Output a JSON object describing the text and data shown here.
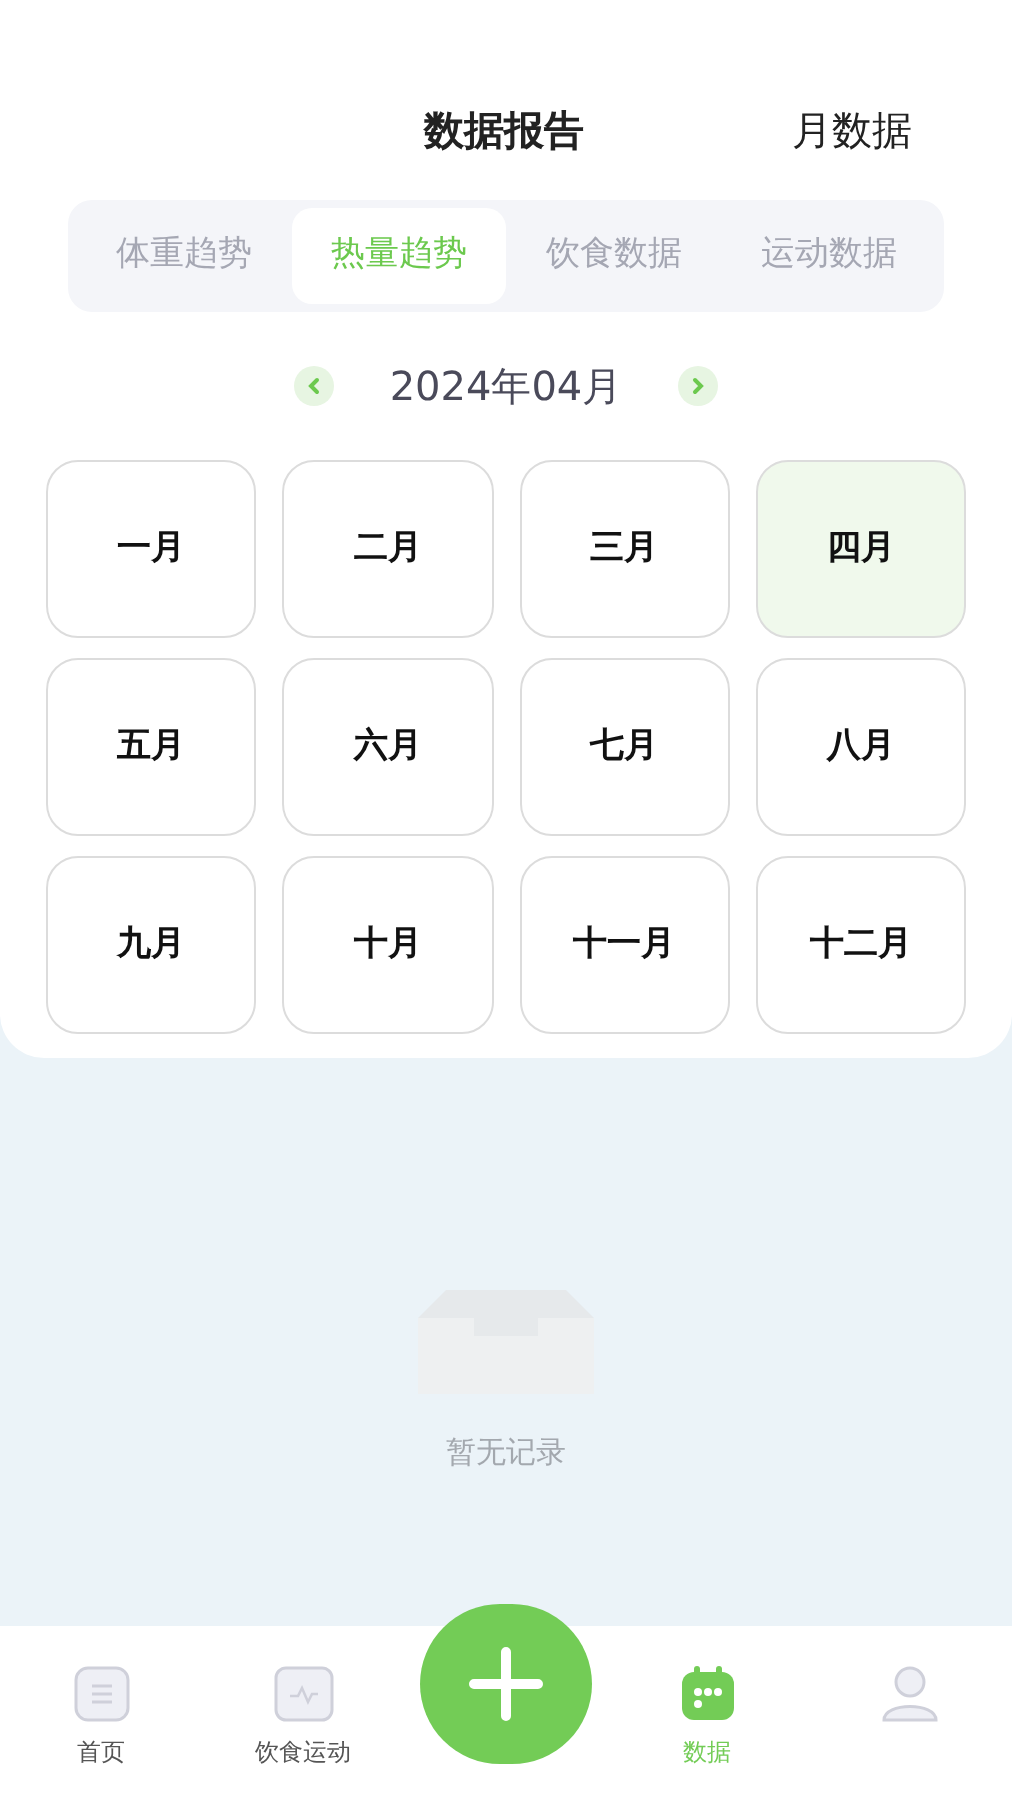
{
  "header": {
    "title": "数据报告",
    "action": "月数据"
  },
  "tabs": [
    {
      "label": "体重趋势",
      "selected": false
    },
    {
      "label": "热量趋势",
      "selected": true
    },
    {
      "label": "饮食数据",
      "selected": false
    },
    {
      "label": "运动数据",
      "selected": false
    }
  ],
  "month_picker": {
    "label": "2024年04月"
  },
  "months": [
    {
      "label": "一月",
      "selected": false
    },
    {
      "label": "二月",
      "selected": false
    },
    {
      "label": "三月",
      "selected": false
    },
    {
      "label": "四月",
      "selected": true
    },
    {
      "label": "五月",
      "selected": false
    },
    {
      "label": "六月",
      "selected": false
    },
    {
      "label": "七月",
      "selected": false
    },
    {
      "label": "八月",
      "selected": false
    },
    {
      "label": "九月",
      "selected": false
    },
    {
      "label": "十月",
      "selected": false
    },
    {
      "label": "十一月",
      "selected": false
    },
    {
      "label": "十二月",
      "selected": false
    }
  ],
  "empty_state": {
    "text": "暂无记录"
  },
  "nav": [
    {
      "kind": "home",
      "label": "首页",
      "selected": false
    },
    {
      "kind": "activity",
      "label": "饮食运动",
      "selected": false
    },
    {
      "kind": "add"
    },
    {
      "kind": "data",
      "label": "数据",
      "selected": true
    },
    {
      "kind": "profile",
      "selected": false
    }
  ]
}
